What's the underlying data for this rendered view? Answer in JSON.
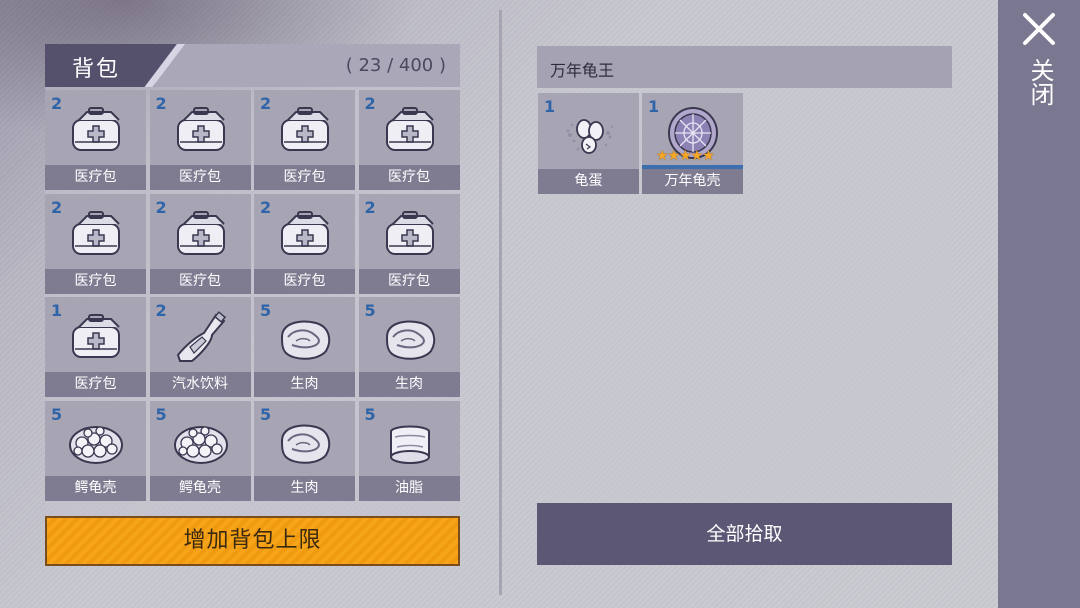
{
  "backpack": {
    "title": "背包",
    "count": "( 23 / 400 )",
    "items": [
      {
        "qty": "2",
        "label": "医疗包",
        "icon": "medkit-icon"
      },
      {
        "qty": "2",
        "label": "医疗包",
        "icon": "medkit-icon"
      },
      {
        "qty": "2",
        "label": "医疗包",
        "icon": "medkit-icon"
      },
      {
        "qty": "2",
        "label": "医疗包",
        "icon": "medkit-icon"
      },
      {
        "qty": "2",
        "label": "医疗包",
        "icon": "medkit-icon"
      },
      {
        "qty": "2",
        "label": "医疗包",
        "icon": "medkit-icon"
      },
      {
        "qty": "2",
        "label": "医疗包",
        "icon": "medkit-icon"
      },
      {
        "qty": "2",
        "label": "医疗包",
        "icon": "medkit-icon"
      },
      {
        "qty": "1",
        "label": "医疗包",
        "icon": "medkit-icon"
      },
      {
        "qty": "2",
        "label": "汽水饮料",
        "icon": "soda-bottle-icon"
      },
      {
        "qty": "5",
        "label": "生肉",
        "icon": "raw-meat-icon"
      },
      {
        "qty": "5",
        "label": "生肉",
        "icon": "raw-meat-icon"
      },
      {
        "qty": "5",
        "label": "鳄龟壳",
        "icon": "snapping-turtle-shell-icon"
      },
      {
        "qty": "5",
        "label": "鳄龟壳",
        "icon": "snapping-turtle-shell-icon"
      },
      {
        "qty": "5",
        "label": "生肉",
        "icon": "raw-meat-icon"
      },
      {
        "qty": "5",
        "label": "油脂",
        "icon": "fat-roll-icon"
      }
    ],
    "expand_button": "增加背包上限"
  },
  "loot": {
    "title": "万年龟王",
    "items": [
      {
        "qty": "1",
        "label": "龟蛋",
        "icon": "turtle-egg-icon",
        "stars": ""
      },
      {
        "qty": "1",
        "label": "万年龟壳",
        "icon": "ancient-turtle-shell-icon",
        "stars": "★★★★★"
      }
    ],
    "pickup_all_button": "全部拾取"
  },
  "close": {
    "label": "关闭"
  },
  "colors": {
    "accent_orange": "#f6a51a",
    "qty_blue": "#2f64a8",
    "star_gold": "#f5a623",
    "panel_dark": "#5c5775"
  }
}
